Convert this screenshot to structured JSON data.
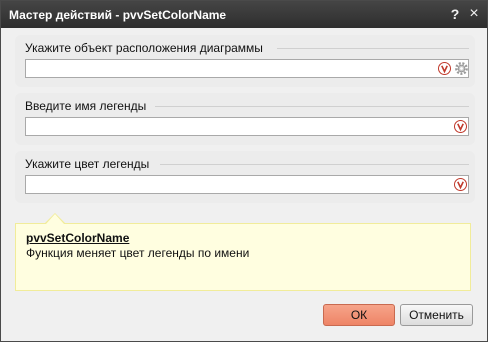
{
  "window": {
    "title": "Мастер действий - pvvSetColorName",
    "help_label": "?",
    "close_label": "×"
  },
  "fields": [
    {
      "label": "Укажите объект расположения диаграммы",
      "value": "",
      "icons": [
        "v-icon",
        "gear-icon"
      ]
    },
    {
      "label": "Введите имя легенды",
      "value": "",
      "icons": [
        "v-icon"
      ]
    },
    {
      "label": "Укажите цвет легенды",
      "value": "",
      "icons": [
        "v-icon"
      ]
    }
  ],
  "info": {
    "title": "pvvSetColorName",
    "description": "Функция меняет цвет легенды по имени"
  },
  "buttons": {
    "ok": "ОК",
    "cancel": "Отменить"
  },
  "colors": {
    "titlebar": "#3a3a3a",
    "ok_button": "#ef8e72",
    "info_background": "#fffee0",
    "v_icon": "#c0392b"
  }
}
